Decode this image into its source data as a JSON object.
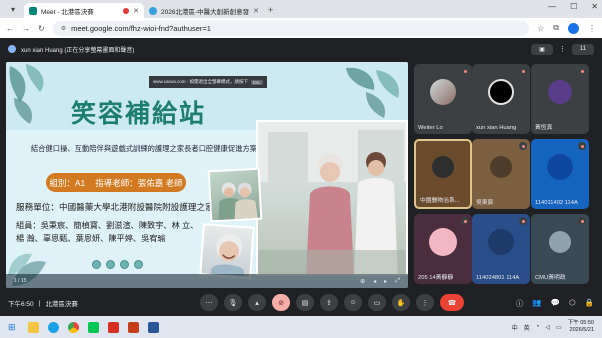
{
  "browser": {
    "tabs": [
      {
        "title": "Meet - 北港區決賽",
        "active": true,
        "recording": true
      },
      {
        "title": "2026北港區-中醫大創新創意發表會",
        "active": false,
        "recording": false
      }
    ],
    "new_tab": "+",
    "url": "meet.google.com/fhz-wioi-fnd?authuser=1"
  },
  "meet": {
    "presenter_label": "xun xian Huang (正在分享螢幕畫面和聲音)",
    "toast_text": "www.canva.com - 如需退出全螢幕模式，請按下",
    "toast_key": "Esc",
    "time": "下午6:50",
    "separator": "|",
    "meeting_name": "北港區決賽",
    "notification_count": "11"
  },
  "slide": {
    "title": "笑容補給站",
    "subtitle": "結合健口操、互動陪伴與遊戲式訓練的護理之家長者口腔健康促進方案",
    "group": "組別：A1",
    "advisor": "指導老師：張佑嘉 老師",
    "unit": "服務單位：中國醫藥大學北港附設醫院附設護理之家",
    "members_line1": "組員：吳秉宸、簡楨寶、劉滋渲、陳致宇、林 立、",
    "members_line2": "楊 瀚、辜恩甄、葉恩妍、陳平婷、吳宥瑜",
    "page": "1 / 15"
  },
  "participants": [
    {
      "name": "Weiter Lo",
      "color": "#3c4043"
    },
    {
      "name": "xun xian Huang",
      "color": "#3c4043"
    },
    {
      "name": "黃恆真",
      "color": "#5a3d8a"
    },
    {
      "name": "中國醫物治系...",
      "color": "#6b4b2e"
    },
    {
      "name": "吳東宸",
      "color": "#7a6040"
    },
    {
      "name": "114011402 114A",
      "color": "#1565c0"
    },
    {
      "name": "205 14黃靜靜",
      "color": "#4a2e3e"
    },
    {
      "name": "114024801 114A",
      "color": "#2a4e8a"
    },
    {
      "name": "CMU黃明政",
      "color": "#3a4a55"
    }
  ],
  "taskbar": {
    "lang1": "中",
    "lang2": "英",
    "time": "下午 05:50",
    "date": "2026/5/21"
  }
}
